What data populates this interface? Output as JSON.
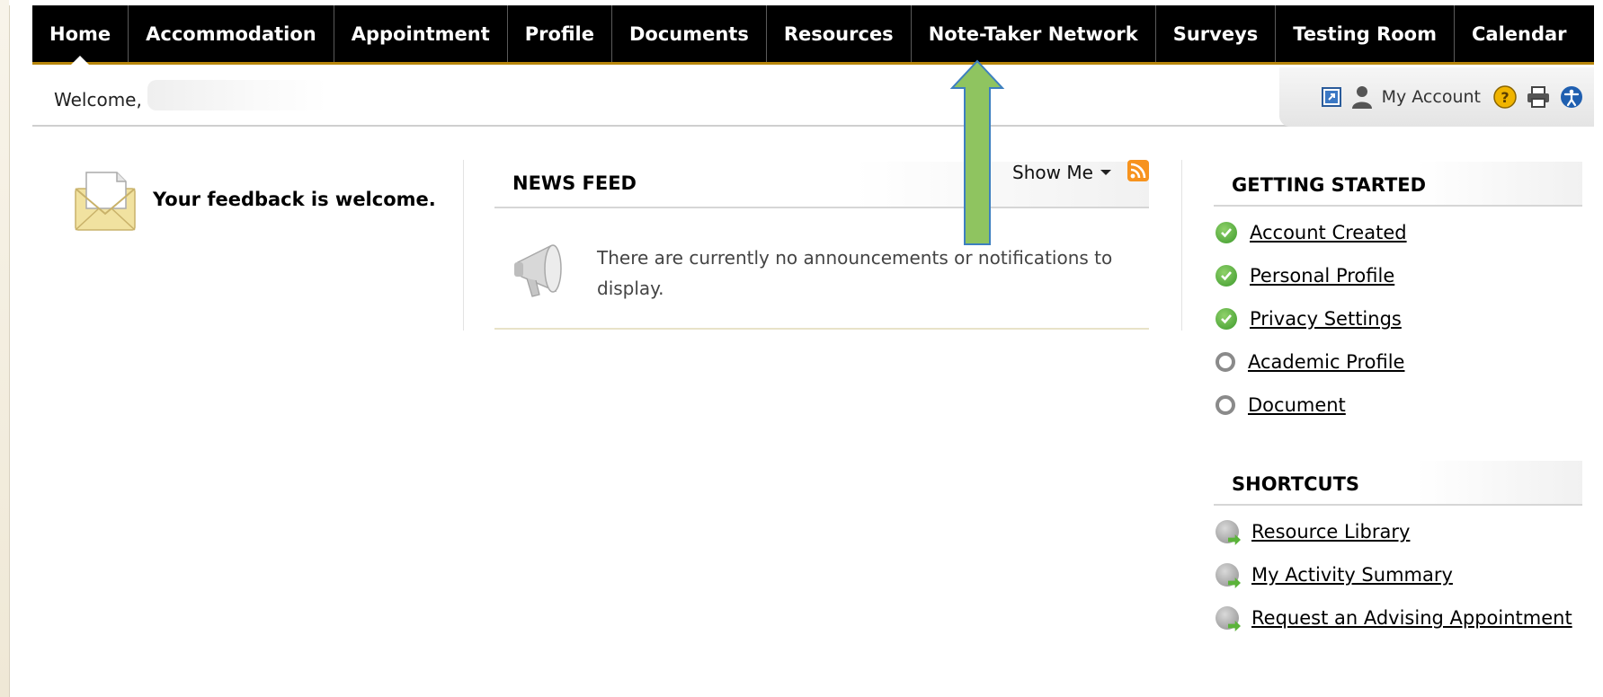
{
  "nav": {
    "items": [
      "Home",
      "Accommodation",
      "Appointment",
      "Profile",
      "Documents",
      "Resources",
      "Note-Taker Network",
      "Surveys",
      "Testing Room",
      "Calendar"
    ],
    "active": "Home"
  },
  "welcome": {
    "text": "Welcome,"
  },
  "account_tools": {
    "my_account_label": "My Account",
    "icons": [
      "external-link-icon",
      "user-icon",
      "help-icon",
      "print-icon",
      "accessibility-icon"
    ]
  },
  "feedback": {
    "text": "Your feedback is welcome."
  },
  "news_feed": {
    "title": "NEWS FEED",
    "show_me_label": "Show Me",
    "message": "There are currently no announcements or notifications to display."
  },
  "getting_started": {
    "title": "GETTING STARTED",
    "items": [
      {
        "label": "Account Created",
        "done": true
      },
      {
        "label": "Personal Profile",
        "done": true
      },
      {
        "label": "Privacy Settings",
        "done": true
      },
      {
        "label": "Academic Profile",
        "done": false
      },
      {
        "label": "Document",
        "done": false
      }
    ]
  },
  "shortcuts": {
    "title": "SHORTCUTS",
    "items": [
      "Resource Library",
      "My Activity Summary",
      "Request an Advising Appointment"
    ]
  },
  "colors": {
    "nav_bg": "#000000",
    "nav_accent": "#b8860b",
    "done_green": "#3d9a2c",
    "rss_orange": "#f7931e",
    "annotation_arrow": "#8fc460"
  }
}
